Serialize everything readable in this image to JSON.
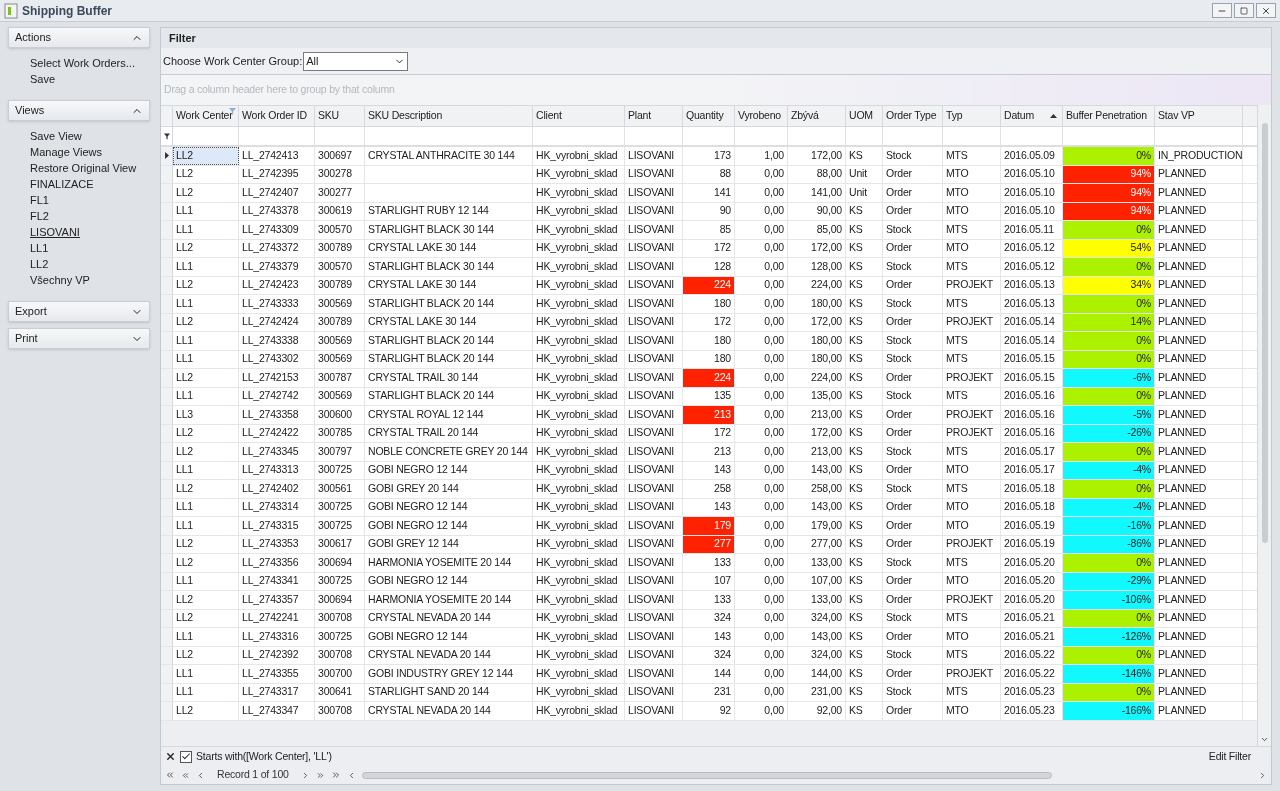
{
  "window": {
    "title": "Shipping Buffer"
  },
  "sidebar": {
    "groups": [
      {
        "title": "Actions",
        "expanded": true,
        "items": [
          {
            "label": "Select Work Orders...",
            "selected": false
          },
          {
            "label": "Save",
            "selected": false
          }
        ]
      },
      {
        "title": "Views",
        "expanded": true,
        "items": [
          {
            "label": "Save View",
            "selected": false
          },
          {
            "label": "Manage Views",
            "selected": false
          },
          {
            "label": "Restore Original View",
            "selected": false
          },
          {
            "label": "FINALIZACE",
            "selected": false
          },
          {
            "label": "FL1",
            "selected": false
          },
          {
            "label": "FL2",
            "selected": false
          },
          {
            "label": "LISOVANI",
            "selected": true
          },
          {
            "label": "LL1",
            "selected": false
          },
          {
            "label": "LL2",
            "selected": false
          },
          {
            "label": "Všechny VP",
            "selected": false
          }
        ]
      },
      {
        "title": "Export",
        "expanded": false
      },
      {
        "title": "Print",
        "expanded": false
      }
    ]
  },
  "filter_panel": {
    "title": "Filter",
    "group_label": "Choose Work Center Group:",
    "group_value": "All"
  },
  "grid": {
    "group_hint": "Drag a column header here to group by that column",
    "columns": [
      {
        "label": "Work Center",
        "filtered": true,
        "sorted": false
      },
      {
        "label": "Work Order ID",
        "filtered": false,
        "sorted": false
      },
      {
        "label": "SKU",
        "filtered": false,
        "sorted": false
      },
      {
        "label": "SKU Description",
        "filtered": false,
        "sorted": false
      },
      {
        "label": "Client",
        "filtered": false,
        "sorted": false
      },
      {
        "label": "Plant",
        "filtered": false,
        "sorted": false
      },
      {
        "label": "Quantity",
        "filtered": false,
        "sorted": false
      },
      {
        "label": "Vyrobeno",
        "filtered": false,
        "sorted": false
      },
      {
        "label": "Zbývá",
        "filtered": false,
        "sorted": false
      },
      {
        "label": "UOM",
        "filtered": false,
        "sorted": false
      },
      {
        "label": "Order Type",
        "filtered": false,
        "sorted": false
      },
      {
        "label": "Typ",
        "filtered": false,
        "sorted": false
      },
      {
        "label": "Datum",
        "filtered": false,
        "sorted": true
      },
      {
        "label": "Buffer Penetration",
        "filtered": false,
        "sorted": false
      },
      {
        "label": "Stav VP",
        "filtered": false,
        "sorted": false
      }
    ],
    "rows": [
      {
        "cells": [
          "LL2",
          "LL_2742413",
          "300697",
          "CRYSTAL ANTHRACITE 30 144",
          "HK_vyrobni_sklad",
          "LISOVANI",
          "173",
          "1,00",
          "172,00",
          "KS",
          "Stock",
          "MTS",
          "2016.05.09",
          "0%",
          "IN_PRODUCTION"
        ],
        "selected": true,
        "quantity_alert": false,
        "color": "#acf200"
      },
      {
        "cells": [
          "LL2",
          "LL_2742395",
          "300278",
          null,
          "HK_vyrobni_sklad",
          "LISOVANI",
          "88",
          "0,00",
          "88,00",
          "Unit",
          "Order",
          "MTO",
          "2016.05.10",
          "94%",
          "PLANNED"
        ],
        "selected": false,
        "quantity_alert": false,
        "color": "#ff2200"
      },
      {
        "cells": [
          "LL2",
          "LL_2742407",
          "300277",
          null,
          "HK_vyrobni_sklad",
          "LISOVANI",
          "141",
          "0,00",
          "141,00",
          "Unit",
          "Order",
          "MTO",
          "2016.05.10",
          "94%",
          "PLANNED"
        ],
        "selected": false,
        "quantity_alert": false,
        "color": "#ff2200"
      },
      {
        "cells": [
          "LL1",
          "LL_2743378",
          "300619",
          "STARLIGHT RUBY 12 144",
          "HK_vyrobni_sklad",
          "LISOVANI",
          "90",
          "0,00",
          "90,00",
          "KS",
          "Order",
          "MTO",
          "2016.05.10",
          "94%",
          "PLANNED"
        ],
        "selected": false,
        "quantity_alert": false,
        "color": "#ff2200"
      },
      {
        "cells": [
          "LL1",
          "LL_2743309",
          "300570",
          "STARLIGHT BLACK 30 144",
          "HK_vyrobni_sklad",
          "LISOVANI",
          "85",
          "0,00",
          "85,00",
          "KS",
          "Stock",
          "MTS",
          "2016.05.11",
          "0%",
          "PLANNED"
        ],
        "selected": false,
        "quantity_alert": false,
        "color": "#acf200"
      },
      {
        "cells": [
          "LL2",
          "LL_2743372",
          "300789",
          "CRYSTAL LAKE 30 144",
          "HK_vyrobni_sklad",
          "LISOVANI",
          "172",
          "0,00",
          "172,00",
          "KS",
          "Order",
          "MTO",
          "2016.05.12",
          "54%",
          "PLANNED"
        ],
        "selected": false,
        "quantity_alert": false,
        "color": "#ffff00"
      },
      {
        "cells": [
          "LL1",
          "LL_2743379",
          "300570",
          "STARLIGHT BLACK 30 144",
          "HK_vyrobni_sklad",
          "LISOVANI",
          "128",
          "0,00",
          "128,00",
          "KS",
          "Stock",
          "MTS",
          "2016.05.12",
          "0%",
          "PLANNED"
        ],
        "selected": false,
        "quantity_alert": false,
        "color": "#acf200"
      },
      {
        "cells": [
          "LL2",
          "LL_2742423",
          "300789",
          "CRYSTAL LAKE 30 144",
          "HK_vyrobni_sklad",
          "LISOVANI",
          "224",
          "0,00",
          "224,00",
          "KS",
          "Order",
          "PROJEKT",
          "2016.05.13",
          "34%",
          "PLANNED"
        ],
        "selected": false,
        "quantity_alert": true,
        "color": "#ffff00"
      },
      {
        "cells": [
          "LL1",
          "LL_2743333",
          "300569",
          "STARLIGHT BLACK 20 144",
          "HK_vyrobni_sklad",
          "LISOVANI",
          "180",
          "0,00",
          "180,00",
          "KS",
          "Stock",
          "MTS",
          "2016.05.13",
          "0%",
          "PLANNED"
        ],
        "selected": false,
        "quantity_alert": false,
        "color": "#acf200"
      },
      {
        "cells": [
          "LL2",
          "LL_2742424",
          "300789",
          "CRYSTAL LAKE 30 144",
          "HK_vyrobni_sklad",
          "LISOVANI",
          "172",
          "0,00",
          "172,00",
          "KS",
          "Order",
          "PROJEKT",
          "2016.05.14",
          "14%",
          "PLANNED"
        ],
        "selected": false,
        "quantity_alert": false,
        "color": "#acf200"
      },
      {
        "cells": [
          "LL1",
          "LL_2743338",
          "300569",
          "STARLIGHT BLACK 20 144",
          "HK_vyrobni_sklad",
          "LISOVANI",
          "180",
          "0,00",
          "180,00",
          "KS",
          "Stock",
          "MTS",
          "2016.05.14",
          "0%",
          "PLANNED"
        ],
        "selected": false,
        "quantity_alert": false,
        "color": "#acf200"
      },
      {
        "cells": [
          "LL1",
          "LL_2743302",
          "300569",
          "STARLIGHT BLACK 20 144",
          "HK_vyrobni_sklad",
          "LISOVANI",
          "180",
          "0,00",
          "180,00",
          "KS",
          "Stock",
          "MTS",
          "2016.05.15",
          "0%",
          "PLANNED"
        ],
        "selected": false,
        "quantity_alert": false,
        "color": "#acf200"
      },
      {
        "cells": [
          "LL2",
          "LL_2742153",
          "300787",
          "CRYSTAL TRAIL 30 144",
          "HK_vyrobni_sklad",
          "LISOVANI",
          "224",
          "0,00",
          "224,00",
          "KS",
          "Order",
          "PROJEKT",
          "2016.05.15",
          "-6%",
          "PLANNED"
        ],
        "selected": false,
        "quantity_alert": true,
        "color": "#11f9ff"
      },
      {
        "cells": [
          "LL1",
          "LL_2742742",
          "300569",
          "STARLIGHT BLACK 20 144",
          "HK_vyrobni_sklad",
          "LISOVANI",
          "135",
          "0,00",
          "135,00",
          "KS",
          "Stock",
          "MTS",
          "2016.05.16",
          "0%",
          "PLANNED"
        ],
        "selected": false,
        "quantity_alert": false,
        "color": "#acf200"
      },
      {
        "cells": [
          "LL3",
          "LL_2743358",
          "300600",
          "CRYSTAL ROYAL 12 144",
          "HK_vyrobni_sklad",
          "LISOVANI",
          "213",
          "0,00",
          "213,00",
          "KS",
          "Order",
          "PROJEKT",
          "2016.05.16",
          "-5%",
          "PLANNED"
        ],
        "selected": false,
        "quantity_alert": true,
        "color": "#11f9ff"
      },
      {
        "cells": [
          "LL2",
          "LL_2742422",
          "300785",
          "CRYSTAL TRAIL 20 144",
          "HK_vyrobni_sklad",
          "LISOVANI",
          "172",
          "0,00",
          "172,00",
          "KS",
          "Order",
          "PROJEKT",
          "2016.05.16",
          "-26%",
          "PLANNED"
        ],
        "selected": false,
        "quantity_alert": false,
        "color": "#11f9ff"
      },
      {
        "cells": [
          "LL2",
          "LL_2743345",
          "300797",
          "NOBLE CONCRETE GREY 20 144",
          "HK_vyrobni_sklad",
          "LISOVANI",
          "213",
          "0,00",
          "213,00",
          "KS",
          "Stock",
          "MTS",
          "2016.05.17",
          "0%",
          "PLANNED"
        ],
        "selected": false,
        "quantity_alert": false,
        "color": "#acf200"
      },
      {
        "cells": [
          "LL1",
          "LL_2743313",
          "300725",
          "GOBI NEGRO 12 144",
          "HK_vyrobni_sklad",
          "LISOVANI",
          "143",
          "0,00",
          "143,00",
          "KS",
          "Order",
          "MTO",
          "2016.05.17",
          "-4%",
          "PLANNED"
        ],
        "selected": false,
        "quantity_alert": false,
        "color": "#11f9ff"
      },
      {
        "cells": [
          "LL2",
          "LL_2742402",
          "300561",
          "GOBI GREY 20 144",
          "HK_vyrobni_sklad",
          "LISOVANI",
          "258",
          "0,00",
          "258,00",
          "KS",
          "Stock",
          "MTS",
          "2016.05.18",
          "0%",
          "PLANNED"
        ],
        "selected": false,
        "quantity_alert": false,
        "color": "#acf200"
      },
      {
        "cells": [
          "LL1",
          "LL_2743314",
          "300725",
          "GOBI NEGRO 12 144",
          "HK_vyrobni_sklad",
          "LISOVANI",
          "143",
          "0,00",
          "143,00",
          "KS",
          "Order",
          "MTO",
          "2016.05.18",
          "-4%",
          "PLANNED"
        ],
        "selected": false,
        "quantity_alert": false,
        "color": "#11f9ff"
      },
      {
        "cells": [
          "LL1",
          "LL_2743315",
          "300725",
          "GOBI NEGRO 12 144",
          "HK_vyrobni_sklad",
          "LISOVANI",
          "179",
          "0,00",
          "179,00",
          "KS",
          "Order",
          "MTO",
          "2016.05.19",
          "-16%",
          "PLANNED"
        ],
        "selected": false,
        "quantity_alert": true,
        "color": "#11f9ff"
      },
      {
        "cells": [
          "LL2",
          "LL_2743353",
          "300617",
          "GOBI GREY 12 144",
          "HK_vyrobni_sklad",
          "LISOVANI",
          "277",
          "0,00",
          "277,00",
          "KS",
          "Order",
          "PROJEKT",
          "2016.05.19",
          "-86%",
          "PLANNED"
        ],
        "selected": false,
        "quantity_alert": true,
        "color": "#11f9ff"
      },
      {
        "cells": [
          "LL2",
          "LL_2743356",
          "300694",
          "HARMONIA YOSEMITE 20 144",
          "HK_vyrobni_sklad",
          "LISOVANI",
          "133",
          "0,00",
          "133,00",
          "KS",
          "Stock",
          "MTS",
          "2016.05.20",
          "0%",
          "PLANNED"
        ],
        "selected": false,
        "quantity_alert": false,
        "color": "#acf200"
      },
      {
        "cells": [
          "LL1",
          "LL_2743341",
          "300725",
          "GOBI NEGRO 12 144",
          "HK_vyrobni_sklad",
          "LISOVANI",
          "107",
          "0,00",
          "107,00",
          "KS",
          "Order",
          "MTO",
          "2016.05.20",
          "-29%",
          "PLANNED"
        ],
        "selected": false,
        "quantity_alert": false,
        "color": "#11f9ff"
      },
      {
        "cells": [
          "LL2",
          "LL_2743357",
          "300694",
          "HARMONIA YOSEMITE 20 144",
          "HK_vyrobni_sklad",
          "LISOVANI",
          "133",
          "0,00",
          "133,00",
          "KS",
          "Order",
          "PROJEKT",
          "2016.05.20",
          "-106%",
          "PLANNED"
        ],
        "selected": false,
        "quantity_alert": false,
        "color": "#11f9ff"
      },
      {
        "cells": [
          "LL2",
          "LL_2742241",
          "300708",
          "CRYSTAL NEVADA 20 144",
          "HK_vyrobni_sklad",
          "LISOVANI",
          "324",
          "0,00",
          "324,00",
          "KS",
          "Stock",
          "MTS",
          "2016.05.21",
          "0%",
          "PLANNED"
        ],
        "selected": false,
        "quantity_alert": false,
        "color": "#acf200"
      },
      {
        "cells": [
          "LL1",
          "LL_2743316",
          "300725",
          "GOBI NEGRO 12 144",
          "HK_vyrobni_sklad",
          "LISOVANI",
          "143",
          "0,00",
          "143,00",
          "KS",
          "Order",
          "MTO",
          "2016.05.21",
          "-126%",
          "PLANNED"
        ],
        "selected": false,
        "quantity_alert": false,
        "color": "#11f9ff"
      },
      {
        "cells": [
          "LL2",
          "LL_2742392",
          "300708",
          "CRYSTAL NEVADA 20 144",
          "HK_vyrobni_sklad",
          "LISOVANI",
          "324",
          "0,00",
          "324,00",
          "KS",
          "Stock",
          "MTS",
          "2016.05.22",
          "0%",
          "PLANNED"
        ],
        "selected": false,
        "quantity_alert": false,
        "color": "#acf200"
      },
      {
        "cells": [
          "LL1",
          "LL_2743355",
          "300700",
          "GOBI INDUSTRY GREY 12 144",
          "HK_vyrobni_sklad",
          "LISOVANI",
          "144",
          "0,00",
          "144,00",
          "KS",
          "Order",
          "PROJEKT",
          "2016.05.22",
          "-146%",
          "PLANNED"
        ],
        "selected": false,
        "quantity_alert": false,
        "color": "#11f9ff"
      },
      {
        "cells": [
          "LL1",
          "LL_2743317",
          "300641",
          "STARLIGHT SAND 20 144",
          "HK_vyrobni_sklad",
          "LISOVANI",
          "231",
          "0,00",
          "231,00",
          "KS",
          "Stock",
          "MTS",
          "2016.05.23",
          "0%",
          "PLANNED"
        ],
        "selected": false,
        "quantity_alert": false,
        "color": "#acf200"
      },
      {
        "cells": [
          "LL2",
          "LL_2743347",
          "300708",
          "CRYSTAL NEVADA 20 144",
          "HK_vyrobni_sklad",
          "LISOVANI",
          "92",
          "0,00",
          "92,00",
          "KS",
          "Order",
          "MTO",
          "2016.05.23",
          "-166%",
          "PLANNED"
        ],
        "selected": false,
        "quantity_alert": false,
        "color": "#11f9ff"
      }
    ],
    "filter_bar": {
      "checked": true,
      "expression": "Starts with([Work Center], 'LL')",
      "edit_label": "Edit Filter"
    },
    "navigator": {
      "record_text": "Record 1 of 100"
    }
  }
}
